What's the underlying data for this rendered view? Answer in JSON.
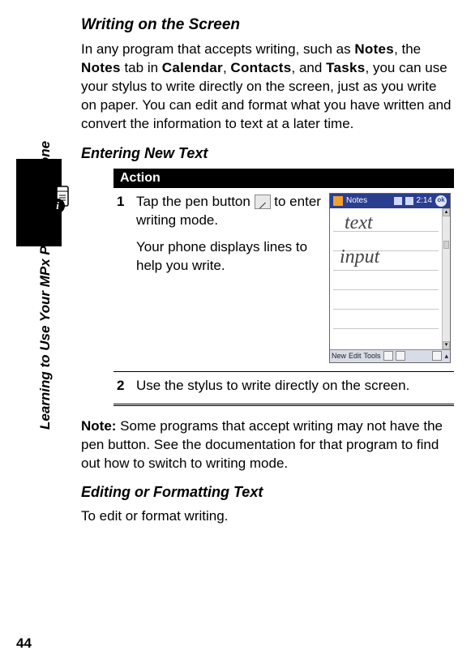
{
  "page_number": "44",
  "side_label": "Learning to Use Your MPx Pocket PC Phone",
  "sections": {
    "writing_title": "Writing on the Screen",
    "writing_intro_1": "In any program that accepts writing, such as ",
    "writing_intro_2": ", the ",
    "writing_intro_3": " tab in ",
    "writing_intro_4": ", ",
    "writing_intro_5": ", and ",
    "writing_intro_6": ", you can use your stylus to write directly on the screen, just as you write on paper. You can edit and format what you have written and convert the information to text at a later time.",
    "app1": "Notes",
    "app2": "Notes",
    "app3": "Calendar",
    "app4": "Contacts",
    "app5": "Tasks",
    "entering_title": "Entering New Text",
    "action_label": "Action",
    "step1_num": "1",
    "step1_a": "Tap the pen button ",
    "step1_b": " to enter writing mode.",
    "step1_line2": "Your phone displays lines to help you write.",
    "step2_num": "2",
    "step2_text": "Use the stylus to write directly on the screen.",
    "note_label": "Note:",
    "note_text": " Some programs that accept writing may not have the pen button. See the documentation for that program to find out how to switch to writing mode.",
    "editing_title": "Editing or Formatting Text",
    "editing_text": "To edit or format writing."
  },
  "screenshot": {
    "app_title": "Notes",
    "time": "2:14",
    "ok": "ok",
    "hand1": "text",
    "hand2": "input",
    "menu_new": "New",
    "menu_edit": "Edit",
    "menu_tools": "Tools"
  }
}
